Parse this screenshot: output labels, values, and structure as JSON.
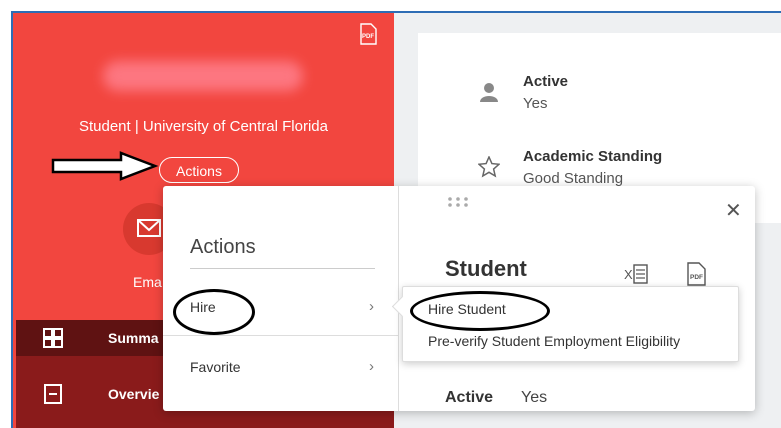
{
  "left": {
    "subtitle": "Student | University of Central Florida",
    "actions_button": "Actions",
    "email_label": "Ema",
    "nav": [
      {
        "label": "Summa"
      },
      {
        "label": "Overvie"
      }
    ]
  },
  "info": [
    {
      "title": "Active",
      "value": "Yes",
      "icon": "person-icon"
    },
    {
      "title": "Academic Standing",
      "value": "Good Standing",
      "icon": "star-icon"
    }
  ],
  "popup": {
    "menu_title": "Actions",
    "menu_items": [
      {
        "label": "Hire"
      },
      {
        "label": "Favorite"
      }
    ],
    "title": "Student",
    "active_label": "Active",
    "active_value": "Yes"
  },
  "submenu": {
    "items": [
      {
        "label": "Hire Student"
      },
      {
        "label": "Pre-verify Student Employment Eligibility"
      }
    ]
  },
  "colors": {
    "panel": "#f2463f",
    "nav_dark": "#8a1b1b",
    "frame_border": "#2d6db5"
  }
}
